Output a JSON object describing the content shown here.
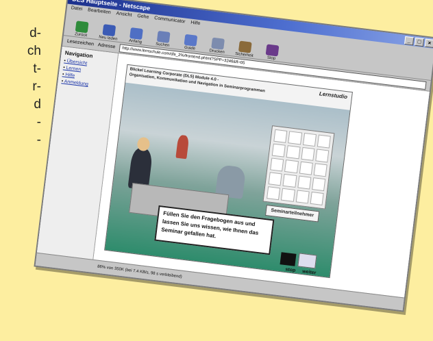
{
  "article": {
    "fragments": [
      "d-",
      "ch",
      "t-",
      "r-",
      "d",
      "-",
      "-"
    ]
  },
  "browser": {
    "title": "DLS Hauptseite - Netscape",
    "menu": [
      "Datei",
      "Bearbeiten",
      "Ansicht",
      "Gehe",
      "Communicator",
      "Hilfe"
    ],
    "toolbar": [
      {
        "label": "Zurück",
        "icon": "back-arrow-icon"
      },
      {
        "label": "Neu laden",
        "icon": "reload-icon"
      },
      {
        "label": "Anfang",
        "icon": "home-icon"
      },
      {
        "label": "Suchen",
        "icon": "search-icon"
      },
      {
        "label": "Guide",
        "icon": "guide-icon"
      },
      {
        "label": "Drucken",
        "icon": "print-icon"
      },
      {
        "label": "Sicherheit",
        "icon": "lock-icon"
      },
      {
        "label": "Stop",
        "icon": "stop-icon"
      }
    ],
    "bookmarks_label": "Lesezeichen",
    "address_label": "Adresse",
    "address_value": "http://www.lernschule.com/dls_2%/frontend.phtml?SPP=3246&fl=05",
    "sidebar": {
      "heading": "Navigation",
      "links": [
        "Übersicht",
        "Lernen",
        "Hilfe",
        "Anmeldung"
      ]
    },
    "scene": {
      "header_line1": "Blickel Learning Corporate (DLS) Module 4.0 -",
      "header_line2": "Organisation, Kommunikation und Navigation in Seminarprogrammen",
      "brand": "Lernstudio",
      "board_label": "Seminarteilnehmer",
      "speech": "Füllen Sie den Fragebogen aus und lassen Sie uns wissen, wie Ihnen das Seminar gefallen hat.",
      "stop_label": "stop",
      "weiter_label": "weiter"
    },
    "status_text": "86% von 350K (bei 7.4 KB/s, 98 s verbleibend)"
  },
  "colors": {
    "page_bg": "#fdeea0",
    "titlebar": "#1b2f8c",
    "scene_floor": "#2e8c6c"
  }
}
